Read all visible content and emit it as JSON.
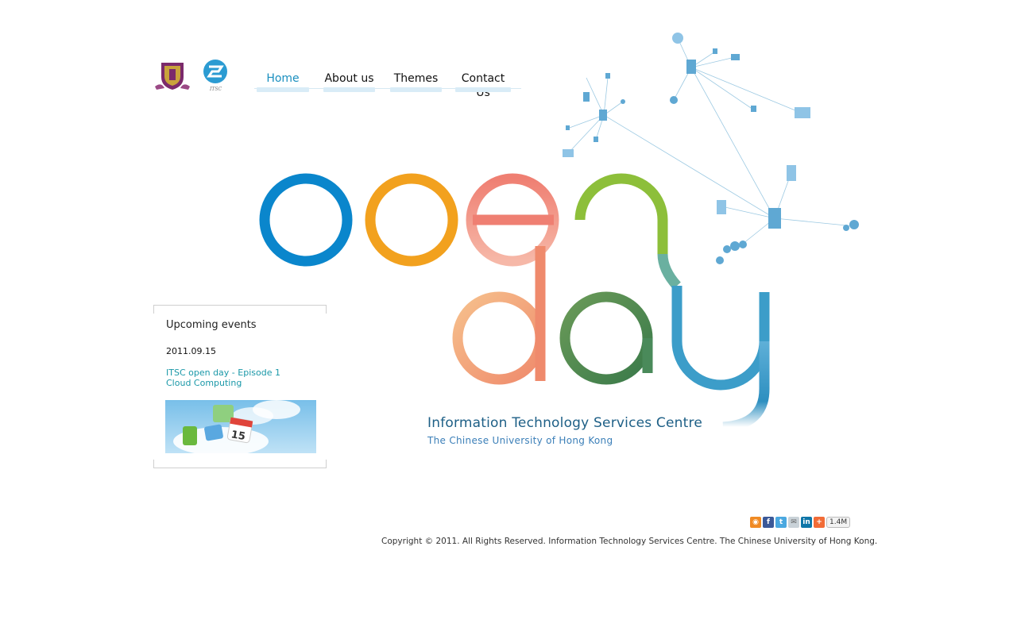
{
  "logos": {
    "cuhk": "cuhk-crest-logo",
    "itsc": "itsc-logo",
    "itsc_caption": "ITSC"
  },
  "nav": {
    "items": [
      {
        "label": "Home",
        "active": true
      },
      {
        "label": "About us",
        "active": false
      },
      {
        "label": "Themes",
        "active": false
      },
      {
        "label": "Contact Us",
        "active": false
      }
    ]
  },
  "events": {
    "title": "Upcoming events",
    "date": "2011.09.15",
    "link_line1": "ITSC open day - Episode 1",
    "link_line2": "Cloud Computing",
    "thumb_calendar_number": "15"
  },
  "hero": {
    "word1": "open",
    "word2": "day",
    "org_name": "Information Technology Services Centre",
    "org_subtitle": "The Chinese University of Hong Kong"
  },
  "share": {
    "icons": [
      "rss-icon",
      "facebook-icon",
      "twitter-icon",
      "email-icon",
      "linkedin-icon",
      "plus-icon"
    ],
    "count": "1.4M"
  },
  "footer": {
    "copyright": "Copyright © 2011. All Rights Reserved. Information Technology Services Centre. The Chinese University of Hong Kong."
  },
  "colors": {
    "accent": "#1a8fbf",
    "link": "#1a98a8",
    "org_title": "#1d5f86",
    "nav_bar": "#d9ecf7"
  }
}
